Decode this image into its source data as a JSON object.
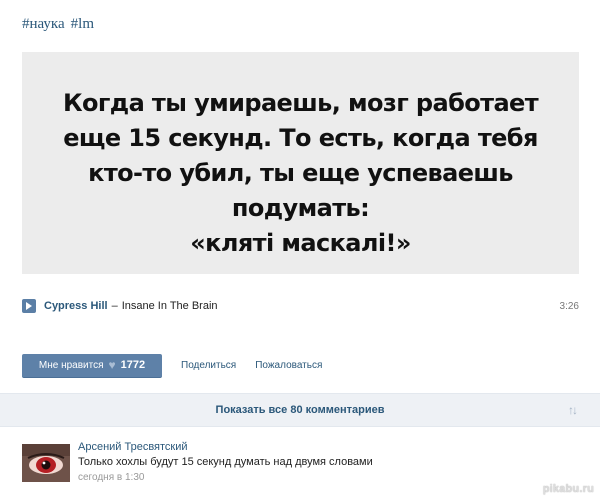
{
  "tags": [
    "#наука",
    "#lm"
  ],
  "meme": {
    "caption_lines": [
      "Когда ты умираешь, мозг работает",
      "еще 15 секунд. То есть, когда тебя",
      "кто-то убил, ты еще успеваешь подумать:",
      "«кляті маскалі!»"
    ]
  },
  "audio": {
    "artist": "Cypress Hill",
    "separator": "–",
    "title": "Insane In The Brain",
    "duration": "3:26",
    "icon": "play-icon"
  },
  "actions": {
    "like_label": "Мне нравится",
    "like_icon": "heart-icon",
    "like_count": "1772",
    "share_label": "Поделиться",
    "report_label": "Пожаловаться"
  },
  "comments_bar": {
    "label": "Показать все 80 комментариев",
    "icon": "sort-icon"
  },
  "comment": {
    "author": "Арсений Тресвятский",
    "text": "Только хохлы будут 15 секунд думать над двумя словами",
    "time": "сегодня в 1:30"
  },
  "watermark": "pikabu.ru",
  "colors": {
    "link": "#2b587a",
    "button": "#5e81a8",
    "bar_bg": "#eef1f5",
    "meme_bg": "#ececec"
  }
}
